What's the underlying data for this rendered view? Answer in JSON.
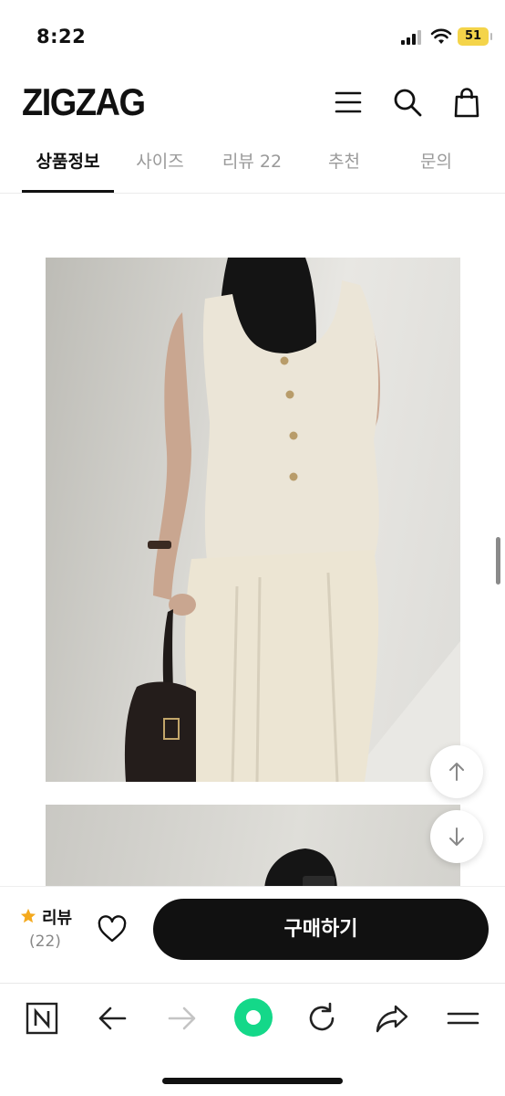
{
  "status_bar": {
    "time": "8:22",
    "battery": "51"
  },
  "header": {
    "logo": "ZIGZAG"
  },
  "tabs": [
    {
      "label": "상품정보"
    },
    {
      "label": "사이즈"
    },
    {
      "label": "리뷰 22"
    },
    {
      "label": "추천"
    },
    {
      "label": "문의"
    }
  ],
  "buy_bar": {
    "review_label": "리뷰",
    "review_count": "(22)",
    "buy_label": "구매하기"
  },
  "colors": {
    "accent_star": "#f4a91d",
    "browser_dot": "#14d889"
  }
}
